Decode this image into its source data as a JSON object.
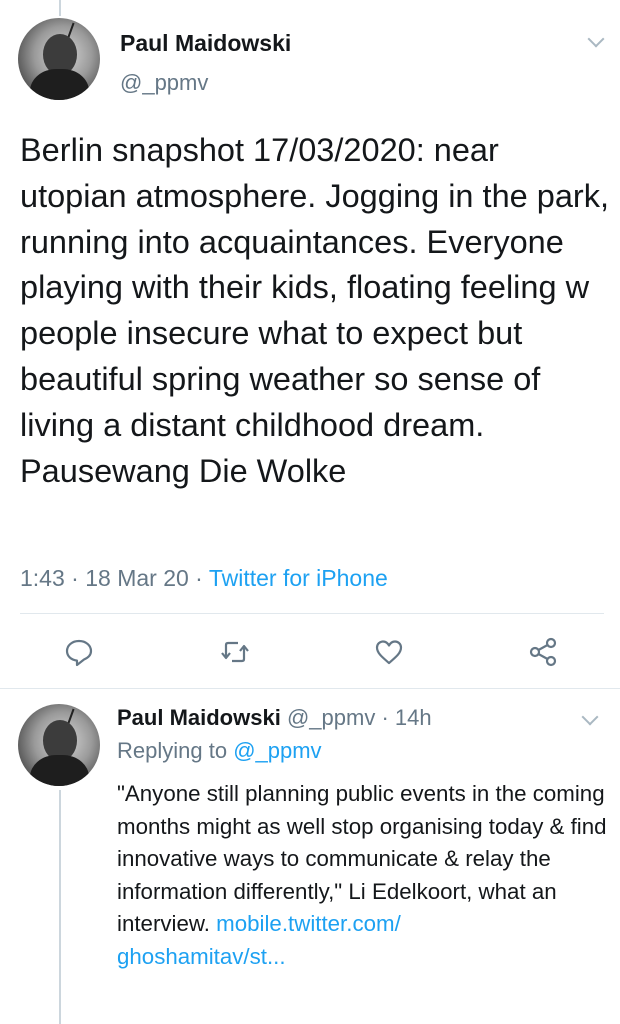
{
  "main_tweet": {
    "author_name": "Paul Maidowski",
    "handle": "@_ppmv",
    "text": "Berlin snapshot 17/03/2020: near utopian atmosphere. Jogging in the park, running into acquaintances. Everyone playing with their kids, floating feeling w people insecure what to expect but beautiful spring weather so sense of living a distant childhood dream. Pausewang Die Wolke",
    "time": "1:43",
    "date": "18 Mar 20",
    "separator": "·",
    "source": "Twitter for iPhone",
    "actions": {
      "reply_icon": "reply-icon",
      "retweet_icon": "retweet-icon",
      "like_icon": "heart-icon",
      "share_icon": "share-icon"
    }
  },
  "reply_tweet": {
    "author_name": "Paul Maidowski",
    "handle": "@_ppmv",
    "separator": "·",
    "age": "14h",
    "replying_prefix": "Replying to ",
    "replying_handle": "@_ppmv",
    "text": "\"Anyone still planning public events in the coming months might as well stop organising today & find innovative ways to communicate & relay the information differently,\" Li Edelkoort, what an interview. ",
    "link_line1": "mobile.twitter.com/",
    "link_line2": "ghoshamitav/st..."
  },
  "colors": {
    "link": "#1da1f2",
    "muted": "#657786",
    "text": "#14171a",
    "divider": "#e1e8ed"
  }
}
